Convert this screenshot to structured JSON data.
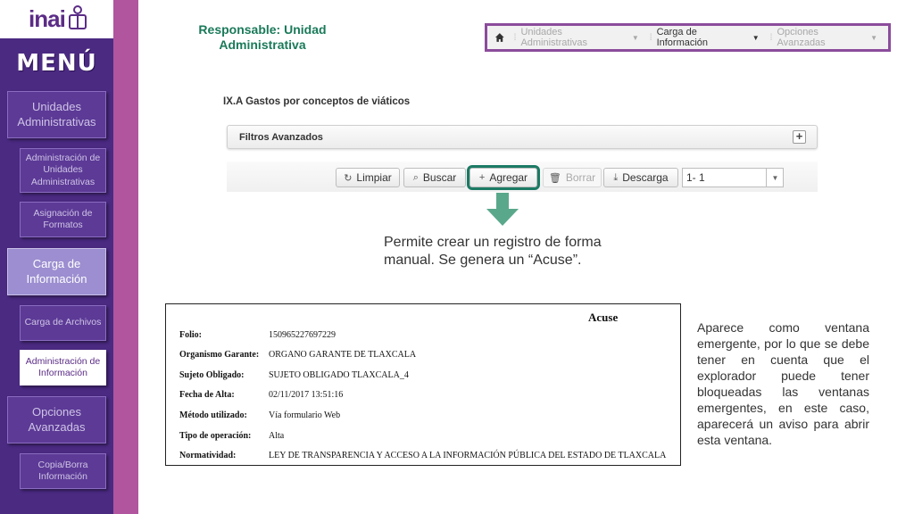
{
  "sidebar": {
    "logo": "inai",
    "menu_title": "MENÚ",
    "items": [
      {
        "label": "Unidades Administrativas",
        "kind": "main"
      },
      {
        "label": "Administración de Unidades Administrativas",
        "kind": "sub"
      },
      {
        "label": "Asignación de Formatos",
        "kind": "sub"
      },
      {
        "label": "Carga de Información",
        "kind": "active"
      },
      {
        "label": "Carga de Archivos",
        "kind": "sub"
      },
      {
        "label": "Administración de Información",
        "kind": "selected"
      },
      {
        "label": "Opciones Avanzadas",
        "kind": "main"
      },
      {
        "label": "Copia/Borra Información",
        "kind": "sub"
      }
    ]
  },
  "header": {
    "responsable": "Responsable: Unidad Administrativa",
    "nav": [
      {
        "label": "Unidades Administrativas"
      },
      {
        "label": "Carga de Información"
      },
      {
        "label": "Opciones Avanzadas"
      }
    ]
  },
  "main": {
    "section_title": "IX.A Gastos por conceptos de viáticos",
    "filters_label": "Filtros Avanzados",
    "toolbar": {
      "limpiar": "Limpiar",
      "buscar": "Buscar",
      "agregar": "Agregar",
      "borrar": "Borrar",
      "descarga": "Descarga",
      "page_value": "1- 1"
    },
    "description": "Permite crear un registro de forma manual. Se genera un “Acuse”."
  },
  "acuse": {
    "title": "Acuse",
    "rows": [
      {
        "label": "Folio:",
        "value": "150965227697229"
      },
      {
        "label": "Organismo Garante:",
        "value": "ORGANO GARANTE DE TLAXCALA"
      },
      {
        "label": "Sujeto Obligado:",
        "value": "SUJETO OBLIGADO TLAXCALA_4"
      },
      {
        "label": "Fecha de Alta:",
        "value": "02/11/2017 13:51:16"
      },
      {
        "label": "Método utilizado:",
        "value": "Vía formulario Web"
      },
      {
        "label": "Tipo de operación:",
        "value": "Alta"
      },
      {
        "label": "Normatividad:",
        "value": "LEY DE TRANSPARENCIA Y ACCESO A LA INFORMACIÓN PÚBLICA DEL ESTADO DE TLAXCALA"
      }
    ]
  },
  "side_note": "Aparece como ventana emergente, por lo que se debe tener en cuenta que el explorador puede tener bloqueadas las ventanas emergentes, en este caso, aparecerá un aviso para abrir esta ventana.",
  "colors": {
    "sidebar": "#4b2a82",
    "stripe": "#b0559e",
    "accent_green": "#1c7a64",
    "nav_border": "#8c4c9c"
  }
}
